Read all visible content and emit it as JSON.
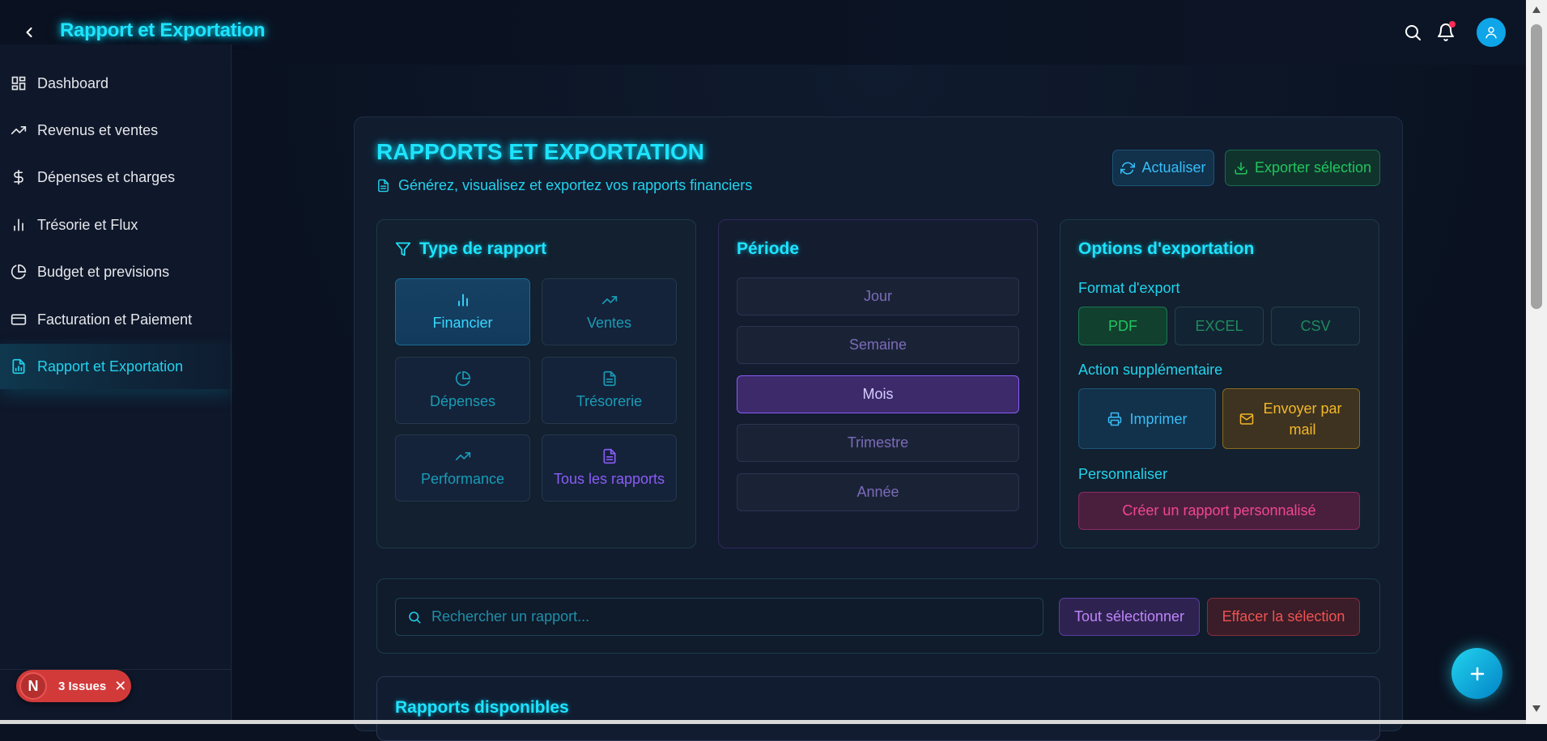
{
  "header": {
    "title": "Rapport et Exportation",
    "icons": [
      "chevron-left-icon",
      "search-icon",
      "bell-icon",
      "user-icon"
    ]
  },
  "sidebar": {
    "items": [
      {
        "label": "Dashboard",
        "icon": "grid-icon",
        "active": false
      },
      {
        "label": "Revenus et ventes",
        "icon": "trending-up-icon",
        "active": false
      },
      {
        "label": "Dépenses et charges",
        "icon": "dollar-icon",
        "active": false
      },
      {
        "label": "Trésorie et Flux",
        "icon": "bar-chart-icon",
        "active": false
      },
      {
        "label": "Budget et previsions",
        "icon": "pie-chart-icon",
        "active": false
      },
      {
        "label": "Facturation et Paiement",
        "icon": "credit-card-icon",
        "active": false
      },
      {
        "label": "Rapport et Exportation",
        "icon": "file-chart-icon",
        "active": true
      }
    ],
    "issues": {
      "badge": "N",
      "label": "3 Issues"
    }
  },
  "page": {
    "title": "RAPPORTS ET EXPORTATION",
    "subtitle": "Générez, visualisez et exportez vos rapports financiers",
    "refresh_label": "Actualiser",
    "export_label": "Exporter sélection"
  },
  "report_type": {
    "title": "Type de rapport",
    "options": [
      {
        "label": "Financier",
        "icon": "bar-chart-icon",
        "active": true
      },
      {
        "label": "Ventes",
        "icon": "trending-up-icon",
        "active": false
      },
      {
        "label": "Dépenses",
        "icon": "pie-chart-icon",
        "active": false
      },
      {
        "label": "Trésorerie",
        "icon": "file-text-icon",
        "active": false
      },
      {
        "label": "Performance",
        "icon": "trending-up-icon",
        "active": false
      },
      {
        "label": "Tous les rapports",
        "icon": "file-text-icon",
        "active": false
      }
    ]
  },
  "period": {
    "title": "Période",
    "options": [
      "Jour",
      "Semaine",
      "Mois",
      "Trimestre",
      "Année"
    ],
    "selected": "Mois"
  },
  "export_options": {
    "title": "Options d'exportation",
    "format_label": "Format d'export",
    "formats": [
      "PDF",
      "EXCEL",
      "CSV"
    ],
    "selected_format": "PDF",
    "action_label": "Action supplémentaire",
    "print_label": "Imprimer",
    "mail_label": "Envoyer par mail",
    "customize_label": "Personnaliser",
    "custom_button": "Créer un rapport personnalisé"
  },
  "search": {
    "placeholder": "Rechercher un rapport...",
    "select_all": "Tout sélectionner",
    "clear": "Effacer la sélection"
  },
  "reports": {
    "title": "Rapports disponibles"
  },
  "colors": {
    "accent": "#1ee3ff",
    "purple": "#8b5cf6",
    "green": "#22c55e",
    "amber": "#f5b729",
    "pink": "#f0478f",
    "red": "#f05252"
  }
}
